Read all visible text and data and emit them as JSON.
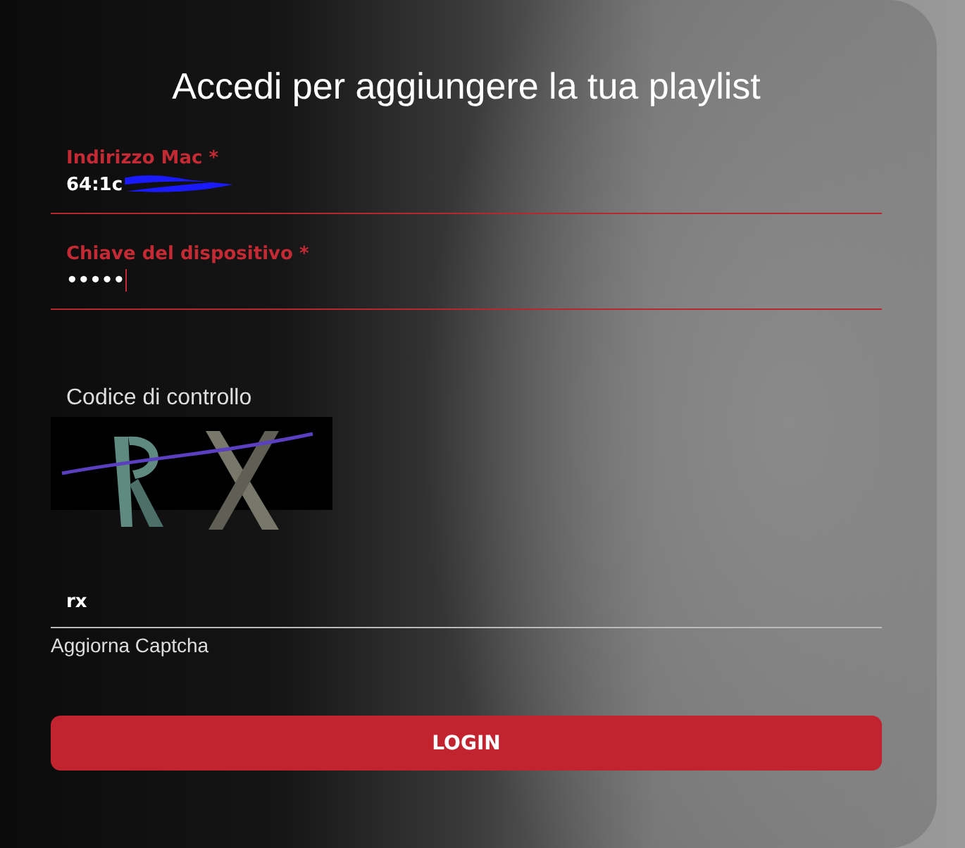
{
  "title": "Accedi per aggiungere la tua playlist",
  "fields": [
    {
      "label": "Indirizzo Mac *",
      "value": "64:1c",
      "redacted": true,
      "focused": false
    },
    {
      "label": "Chiave del dispositivo *",
      "value": "•••••",
      "redacted": false,
      "focused": true
    }
  ],
  "captcha": {
    "label": "Codice di controllo",
    "kind": "picture",
    "answer": "rx",
    "refresh_link": "Aggiorna Captcha"
  },
  "login_button": "LOGIN"
}
